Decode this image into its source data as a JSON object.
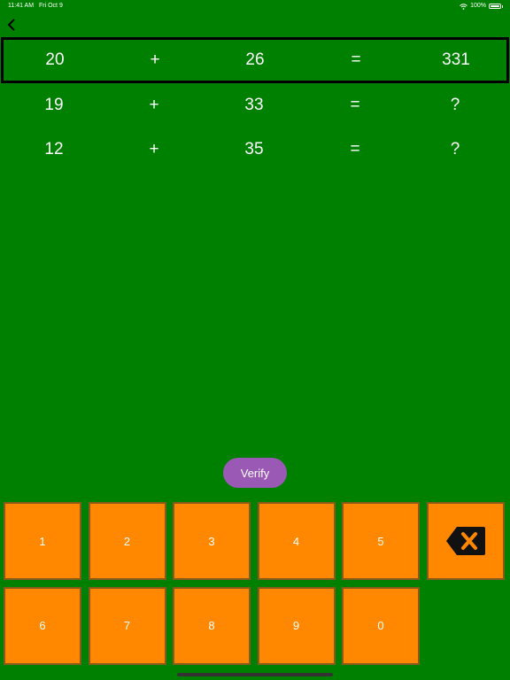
{
  "status_bar": {
    "time": "11:41 AM",
    "date": "Fri Oct 9",
    "battery": "100%"
  },
  "equations": [
    {
      "a": "20",
      "op": "+",
      "b": "26",
      "eq": "=",
      "result": "331"
    },
    {
      "a": "19",
      "op": "+",
      "b": "33",
      "eq": "=",
      "result": "?"
    },
    {
      "a": "12",
      "op": "+",
      "b": "35",
      "eq": "=",
      "result": "?"
    }
  ],
  "verify_label": "Verify",
  "keypad": {
    "keys": [
      "1",
      "2",
      "3",
      "4",
      "5",
      "6",
      "7",
      "8",
      "9",
      "0"
    ],
    "backspace_icon": "backspace-icon"
  },
  "colors": {
    "background": "#008000",
    "key": "#ff8800",
    "verify": "#9b59b6"
  }
}
